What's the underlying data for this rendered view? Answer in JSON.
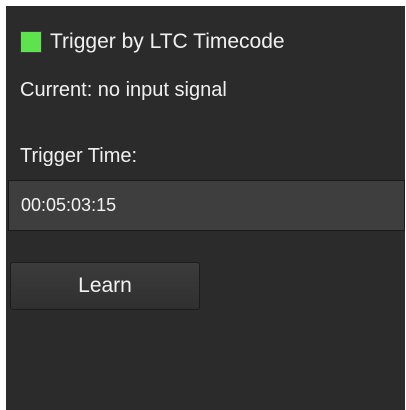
{
  "trigger": {
    "label": "Trigger by LTC Timecode",
    "checked": true,
    "checkbox_color": "#5ee34f"
  },
  "status": {
    "current": "Current: no input signal"
  },
  "trigger_time": {
    "label": "Trigger Time:",
    "value": "00:05:03:15"
  },
  "actions": {
    "learn_label": "Learn"
  },
  "colors": {
    "panel_background": "#2b2b2b",
    "field_background": "#3e3e3e",
    "text": "#f0f0f0"
  }
}
